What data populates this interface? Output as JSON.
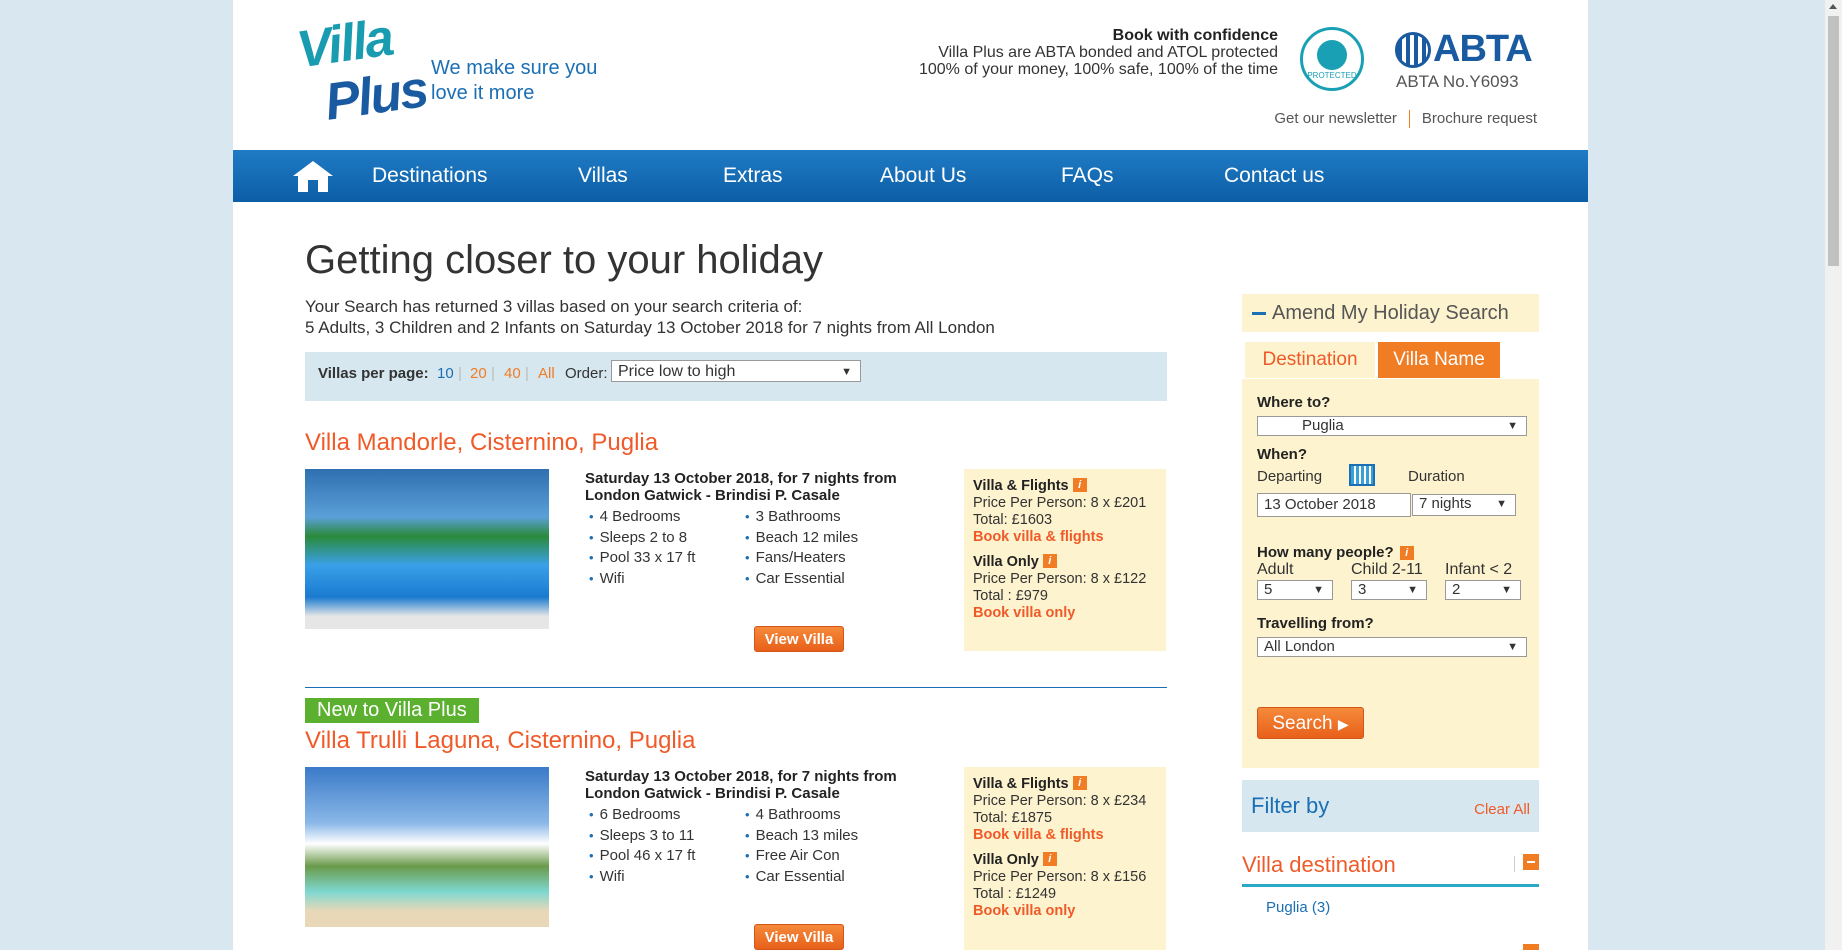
{
  "header": {
    "logo_text_1": "Villa",
    "logo_text_2": "Plus",
    "tagline": "We make sure you love it more",
    "confidence_title": "Book with confidence",
    "confidence_line1": "Villa Plus are ABTA bonded and ATOL protected",
    "confidence_line2": "100% of your money, 100% safe, 100% of the time",
    "atol_badge_text": "PROTECTED",
    "abta_logo": "ABTA",
    "abta_number": "ABTA No.Y6093",
    "newsletter_link": "Get our newsletter",
    "brochure_link": "Brochure request"
  },
  "nav": {
    "home_icon": "home-icon",
    "items": [
      "Destinations",
      "Villas",
      "Extras",
      "About Us",
      "FAQs",
      "Contact us"
    ]
  },
  "main": {
    "title": "Getting closer to your holiday",
    "summary_line1": "Your Search has returned 3 villas based on your search criteria of:",
    "summary_line2": "5 Adults, 3 Children and 2 Infants on Saturday 13 October 2018 for 7 nights from All London",
    "villas_per_page_label": "Villas per page:",
    "per_page_options": [
      "10",
      "20",
      "40",
      "All"
    ],
    "order_label": "Order:",
    "order_value": "Price low to high"
  },
  "villas": [
    {
      "name": "Villa Mandorle, Cisternino, Puglia",
      "dates": "Saturday 13 October 2018, for 7 nights from London Gatwick - Brindisi P. Casale",
      "features_left": [
        "4 Bedrooms",
        "Sleeps 2 to 8",
        "Pool 33 x 17 ft",
        "Wifi"
      ],
      "features_right": [
        "3 Bathrooms",
        "Beach 12 miles",
        "Fans/Heaters",
        "Car Essential"
      ],
      "view_label": "View Villa",
      "vf_title": "Villa & Flights",
      "vf_ppp": "Price Per Person: 8 x £201",
      "vf_total": "Total: £1603",
      "vf_book": "Book villa & flights",
      "vo_title": "Villa Only",
      "vo_ppp": "Price Per Person: 8 x £122",
      "vo_total": "Total : £979",
      "vo_book": "Book villa only"
    },
    {
      "badge": "New to Villa Plus",
      "name": "Villa Trulli Laguna, Cisternino, Puglia",
      "dates": "Saturday 13 October 2018, for 7 nights from London Gatwick - Brindisi P. Casale",
      "features_left": [
        "6 Bedrooms",
        "Sleeps 3 to 11",
        "Pool 46 x 17 ft",
        "Wifi"
      ],
      "features_right": [
        "4 Bathrooms",
        "Beach 13 miles",
        "Free Air Con",
        "Car Essential"
      ],
      "view_label": "View Villa",
      "vf_title": "Villa & Flights",
      "vf_ppp": "Price Per Person: 8 x £234",
      "vf_total": "Total: £1875",
      "vf_book": "Book villa & flights",
      "vo_title": "Villa Only",
      "vo_ppp": "Price Per Person: 8 x £156",
      "vo_total": "Total : £1249",
      "vo_book": "Book villa only"
    }
  ],
  "sidebar": {
    "amend_title": "Amend My Holiday Search",
    "tab_destination": "Destination",
    "tab_villa_name": "Villa Name",
    "where_label": "Where to?",
    "where_value": "Puglia",
    "when_label": "When?",
    "departing_label": "Departing",
    "duration_label": "Duration",
    "departing_value": "13 October 2018",
    "duration_value": "7 nights",
    "people_label": "How many people?",
    "adult_label": "Adult",
    "child_label": "Child 2-11",
    "infant_label": "Infant < 2",
    "adult_value": "5",
    "child_value": "3",
    "infant_value": "2",
    "travelling_label": "Travelling from?",
    "travelling_value": "All London",
    "search_label": "Search",
    "filter_title": "Filter by",
    "clear_all": "Clear All",
    "villa_destination": "Villa destination",
    "puglia_filter": "Puglia (3)",
    "info_glyph": "i"
  },
  "colors": {
    "brand_blue": "#1a6fb5",
    "accent_orange": "#f07c24",
    "title_orange": "#f05a28",
    "panel_cream": "#fdf3cf",
    "new_badge_green": "#5cb030"
  }
}
